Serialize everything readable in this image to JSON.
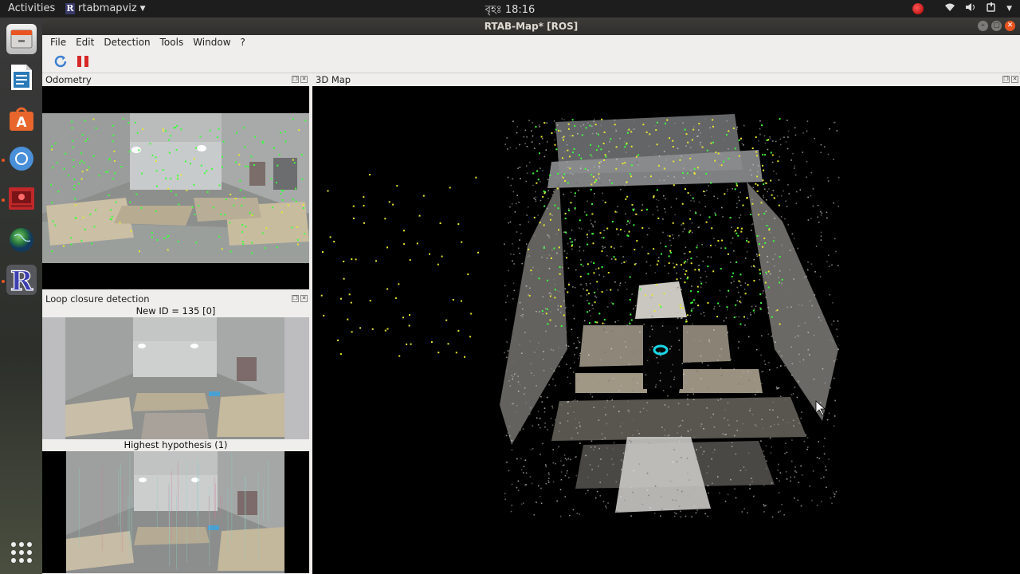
{
  "topbar": {
    "activities": "Activities",
    "app_name": "rtabmapviz",
    "clock": "বৃহঃ 18:16"
  },
  "dock": {
    "items": [
      {
        "icon": "files-icon"
      },
      {
        "icon": "writer-icon"
      },
      {
        "icon": "software-center-icon"
      },
      {
        "icon": "chromium-icon"
      },
      {
        "icon": "screen-recorder-icon"
      },
      {
        "icon": "globe-icon"
      },
      {
        "icon": "rtabmap-icon"
      }
    ],
    "show_apps_icon": "grid-icon"
  },
  "window": {
    "title": "RTAB-Map* [ROS]",
    "menu": [
      "File",
      "Edit",
      "Detection",
      "Tools",
      "Window",
      "?"
    ]
  },
  "panels": {
    "odometry": {
      "title": "Odometry"
    },
    "loop_closure": {
      "title": "Loop closure detection",
      "new_id_caption": "New ID = 135 [0]",
      "hypothesis_caption": "Highest hypothesis (1)"
    },
    "map3d": {
      "title": "3D Map"
    }
  },
  "colors": {
    "accent": "#e95420",
    "feature_green": "#3cff3c",
    "feature_yellow": "#e8e830",
    "pose_cyan": "#19d6e6"
  }
}
